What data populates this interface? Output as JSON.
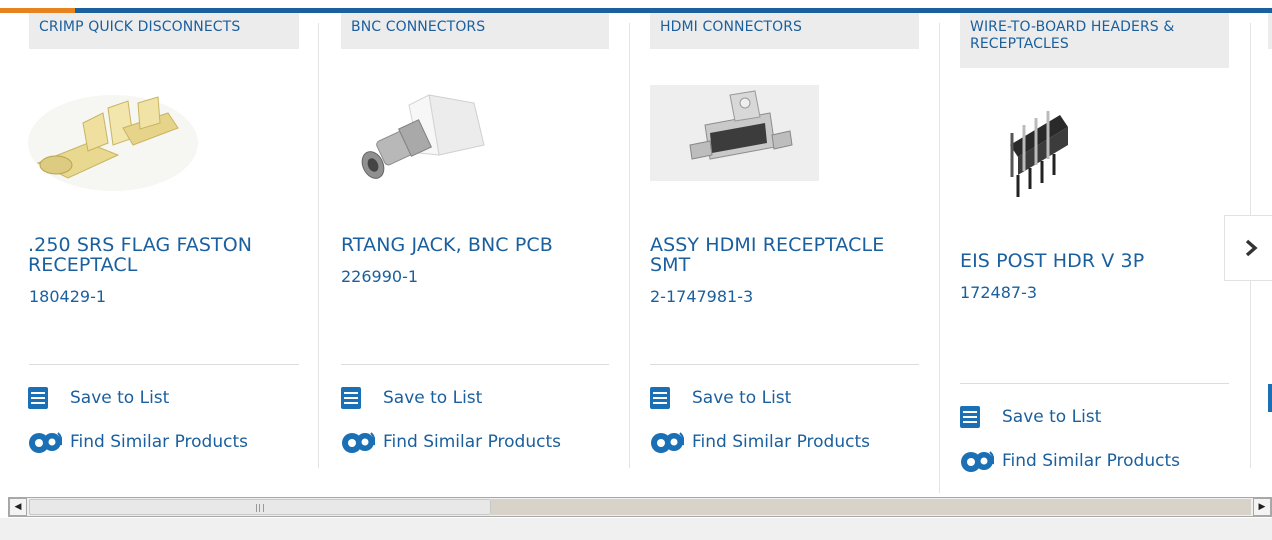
{
  "carousel": {
    "products": [
      {
        "category": "CRIMP QUICK DISCONNECTS",
        "title": ".250 SRS FLAG FASTON RECEPTACL",
        "part_number": "180429-1",
        "save_label": "Save to List",
        "similar_label": "Find Similar Products",
        "image": "flag-faston-receptacle"
      },
      {
        "category": "BNC CONNECTORS",
        "title": "RTANG JACK, BNC PCB",
        "part_number": "226990-1",
        "save_label": "Save to List",
        "similar_label": "Find Similar Products",
        "image": "bnc-jack"
      },
      {
        "category": "HDMI CONNECTORS",
        "title": "ASSY HDMI RECEPTACLE SMT",
        "part_number": "2-1747981-3",
        "save_label": "Save to List",
        "similar_label": "Find Similar Products",
        "image": "hdmi-receptacle"
      },
      {
        "category": "WIRE-TO-BOARD HEADERS & RECEPTACLES",
        "title": "EIS POST HDR V 3P",
        "part_number": "172487-3",
        "save_label": "Save to List",
        "similar_label": "Find Similar Products",
        "image": "post-header"
      }
    ],
    "next_icon": "chevron-right-icon"
  },
  "colors": {
    "brand_blue": "#1a5f9e",
    "accent_orange": "#e8821e",
    "tag_bg": "#ececec"
  },
  "scrollbar": {
    "grip": "III"
  }
}
